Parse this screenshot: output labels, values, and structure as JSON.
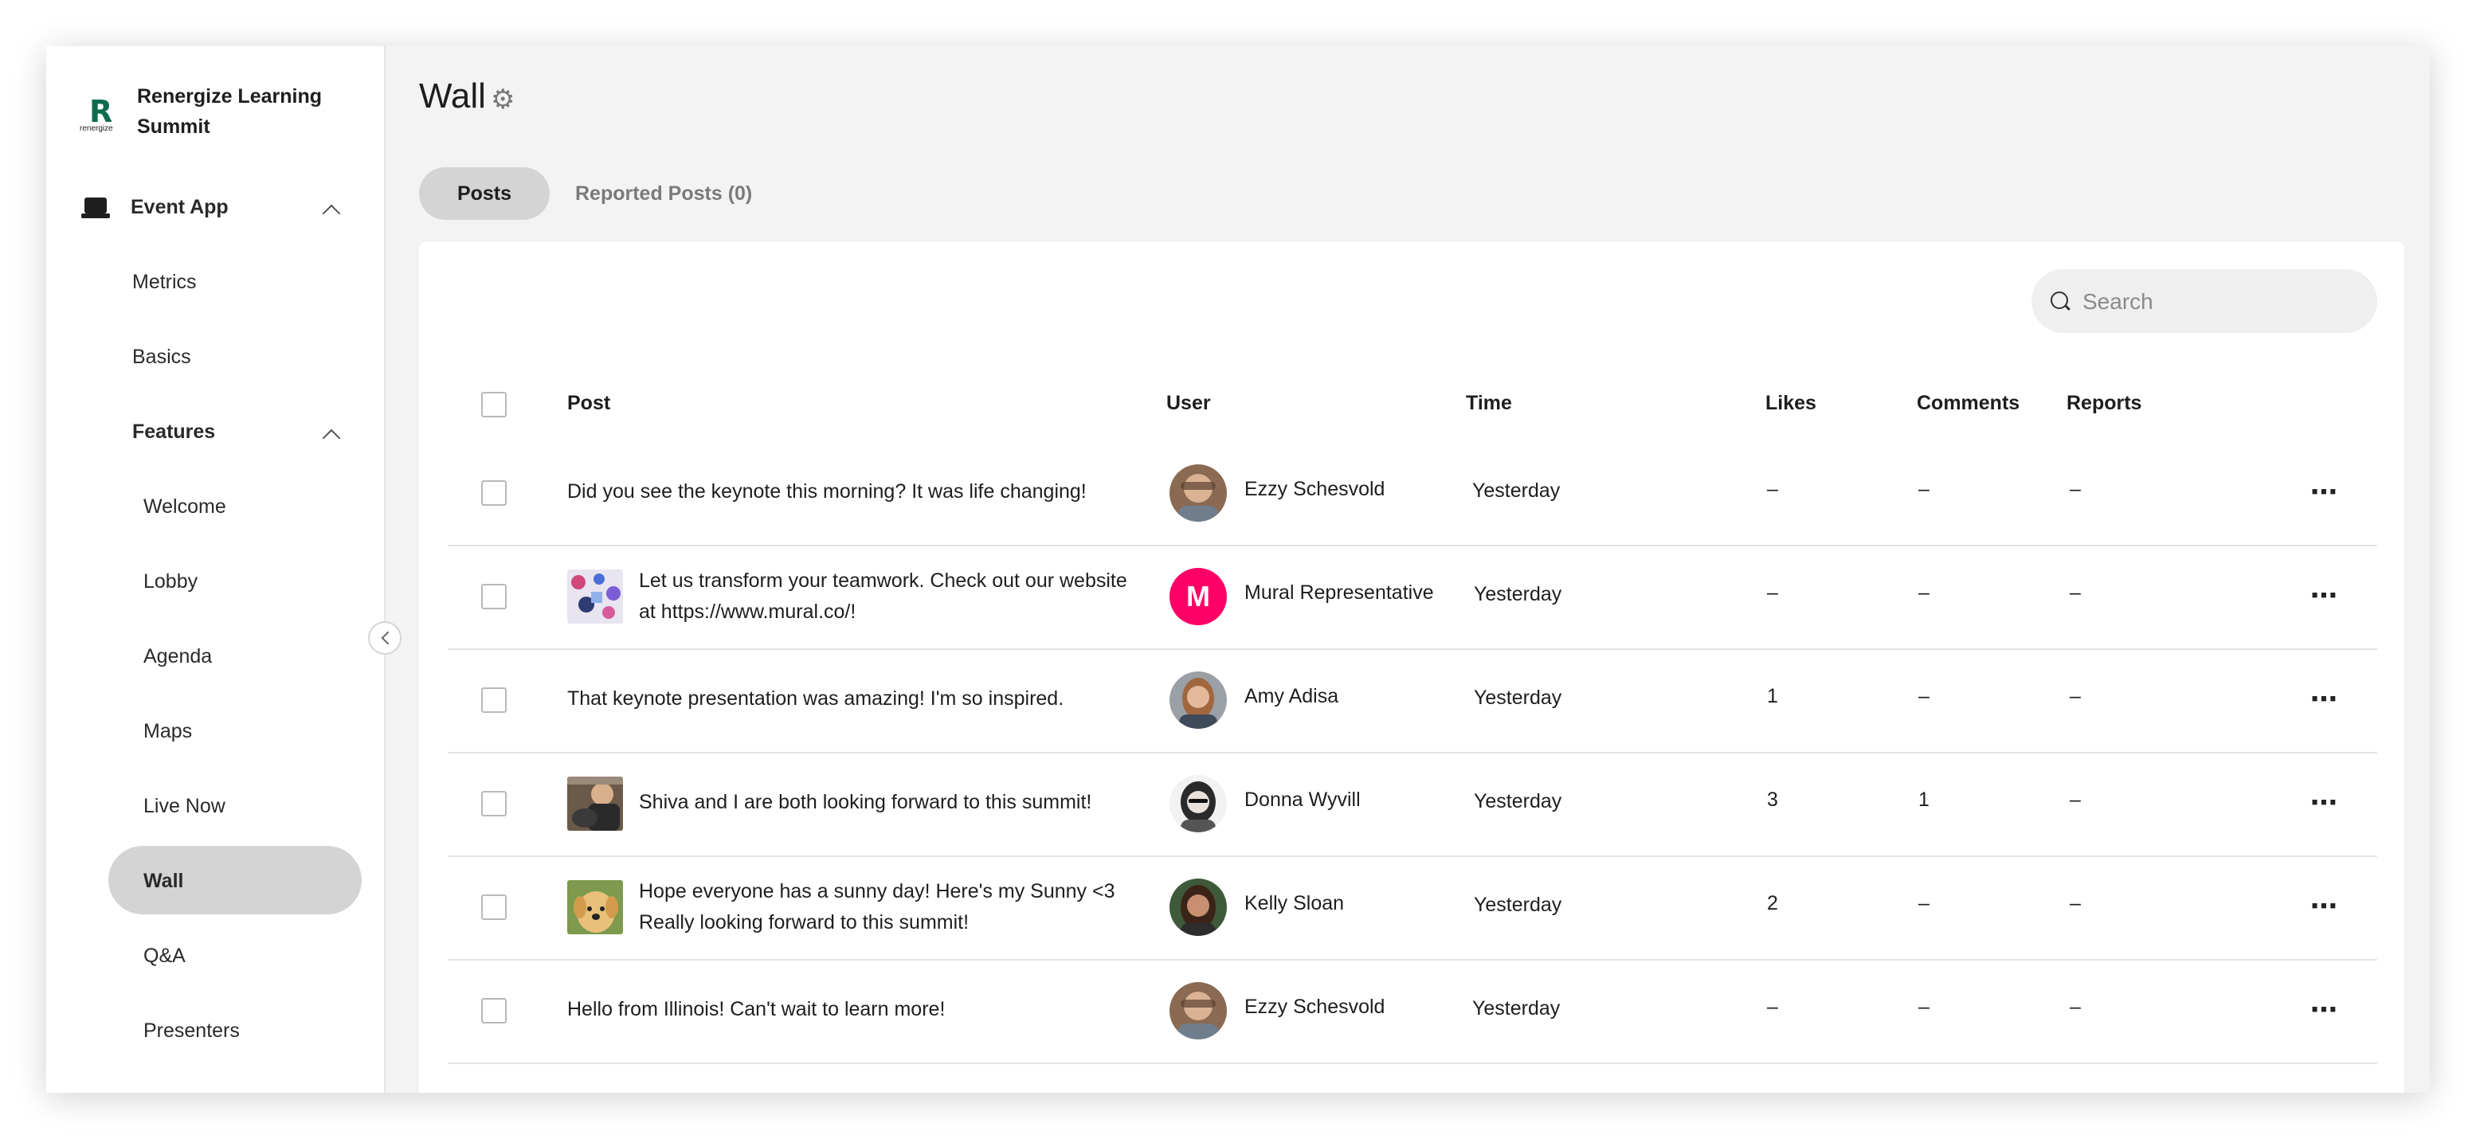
{
  "brand": {
    "name": "Renergize Learning Summit",
    "logo_mark": "R",
    "logo_word": "renergize"
  },
  "sidebar": {
    "event_app_label": "Event App",
    "metrics": "Metrics",
    "basics": "Basics",
    "features_label": "Features",
    "features": [
      "Welcome",
      "Lobby",
      "Agenda",
      "Maps",
      "Live Now",
      "Wall",
      "Q&A",
      "Presenters"
    ],
    "active_item": "Wall"
  },
  "page": {
    "title": "Wall"
  },
  "tabs": {
    "posts": "Posts",
    "reported": "Reported Posts (0)"
  },
  "search": {
    "placeholder": "Search"
  },
  "table": {
    "headers": {
      "post": "Post",
      "user": "User",
      "time": "Time",
      "likes": "Likes",
      "comments": "Comments",
      "reports": "Reports"
    },
    "rows": [
      {
        "post": "Did you see the keynote this morning? It was life changing!",
        "user": "Ezzy Schesvold",
        "time": "Yesterday",
        "likes": "–",
        "comments": "–",
        "reports": "–"
      },
      {
        "post_l1": "Let us transform your teamwork. Check out our website",
        "post_l2": "at https://www.mural.co/!",
        "user": "Mural Representative",
        "avatar_letter": "M",
        "time": "Yesterday",
        "likes": "–",
        "comments": "–",
        "reports": "–"
      },
      {
        "post": "That keynote presentation was amazing! I'm so inspired.",
        "user": "Amy Adisa",
        "time": "Yesterday",
        "likes": "1",
        "comments": "–",
        "reports": "–"
      },
      {
        "post": "Shiva and I are both looking forward to this summit!",
        "user": "Donna Wyvill",
        "time": "Yesterday",
        "likes": "3",
        "comments": "1",
        "reports": "–"
      },
      {
        "post_l1": "Hope everyone has a sunny day! Here's my Sunny <3",
        "post_l2": "Really looking forward to this summit!",
        "user": "Kelly Sloan",
        "time": "Yesterday",
        "likes": "2",
        "comments": "–",
        "reports": "–"
      },
      {
        "post": "Hello from Illinois! Can't wait to learn more!",
        "user": "Ezzy Schesvold",
        "time": "Yesterday",
        "likes": "–",
        "comments": "–",
        "reports": "–"
      }
    ]
  },
  "colors": {
    "mural_brand": "#ff0066",
    "active_pill": "#d4d4d4",
    "logo_green": "#0f6b4f"
  }
}
